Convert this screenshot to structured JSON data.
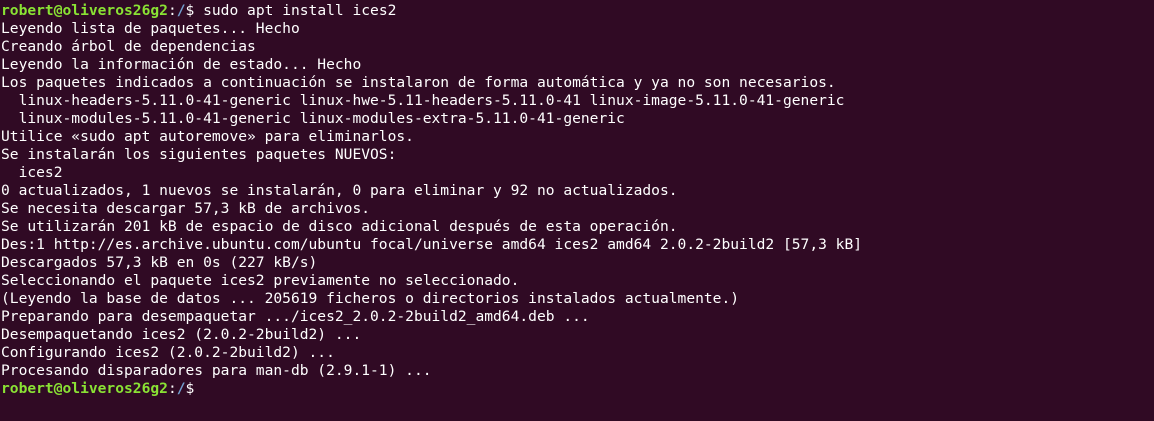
{
  "colors": {
    "background": "#300a24",
    "text": "#ffffff",
    "user_host": "#8ae234",
    "path": "#729fcf"
  },
  "prompt1": {
    "user_host": "robert@oliveros26g2",
    "sep": ":",
    "path": "/",
    "symbol": "$",
    "command": " sudo apt install ices2"
  },
  "output": [
    "Leyendo lista de paquetes... Hecho",
    "Creando árbol de dependencias",
    "Leyendo la información de estado... Hecho",
    "Los paquetes indicados a continuación se instalaron de forma automática y ya no son necesarios.",
    "  linux-headers-5.11.0-41-generic linux-hwe-5.11-headers-5.11.0-41 linux-image-5.11.0-41-generic",
    "  linux-modules-5.11.0-41-generic linux-modules-extra-5.11.0-41-generic",
    "Utilice «sudo apt autoremove» para eliminarlos.",
    "Se instalarán los siguientes paquetes NUEVOS:",
    "  ices2",
    "0 actualizados, 1 nuevos se instalarán, 0 para eliminar y 92 no actualizados.",
    "Se necesita descargar 57,3 kB de archivos.",
    "Se utilizarán 201 kB de espacio de disco adicional después de esta operación.",
    "Des:1 http://es.archive.ubuntu.com/ubuntu focal/universe amd64 ices2 amd64 2.0.2-2build2 [57,3 kB]",
    "Descargados 57,3 kB en 0s (227 kB/s)",
    "Seleccionando el paquete ices2 previamente no seleccionado.",
    "(Leyendo la base de datos ... 205619 ficheros o directorios instalados actualmente.)",
    "Preparando para desempaquetar .../ices2_2.0.2-2build2_amd64.deb ...",
    "Desempaquetando ices2 (2.0.2-2build2) ...",
    "Configurando ices2 (2.0.2-2build2) ...",
    "Procesando disparadores para man-db (2.9.1-1) ..."
  ],
  "prompt2": {
    "user_host": "robert@oliveros26g2",
    "sep": ":",
    "path": "/",
    "symbol": "$",
    "command": ""
  }
}
